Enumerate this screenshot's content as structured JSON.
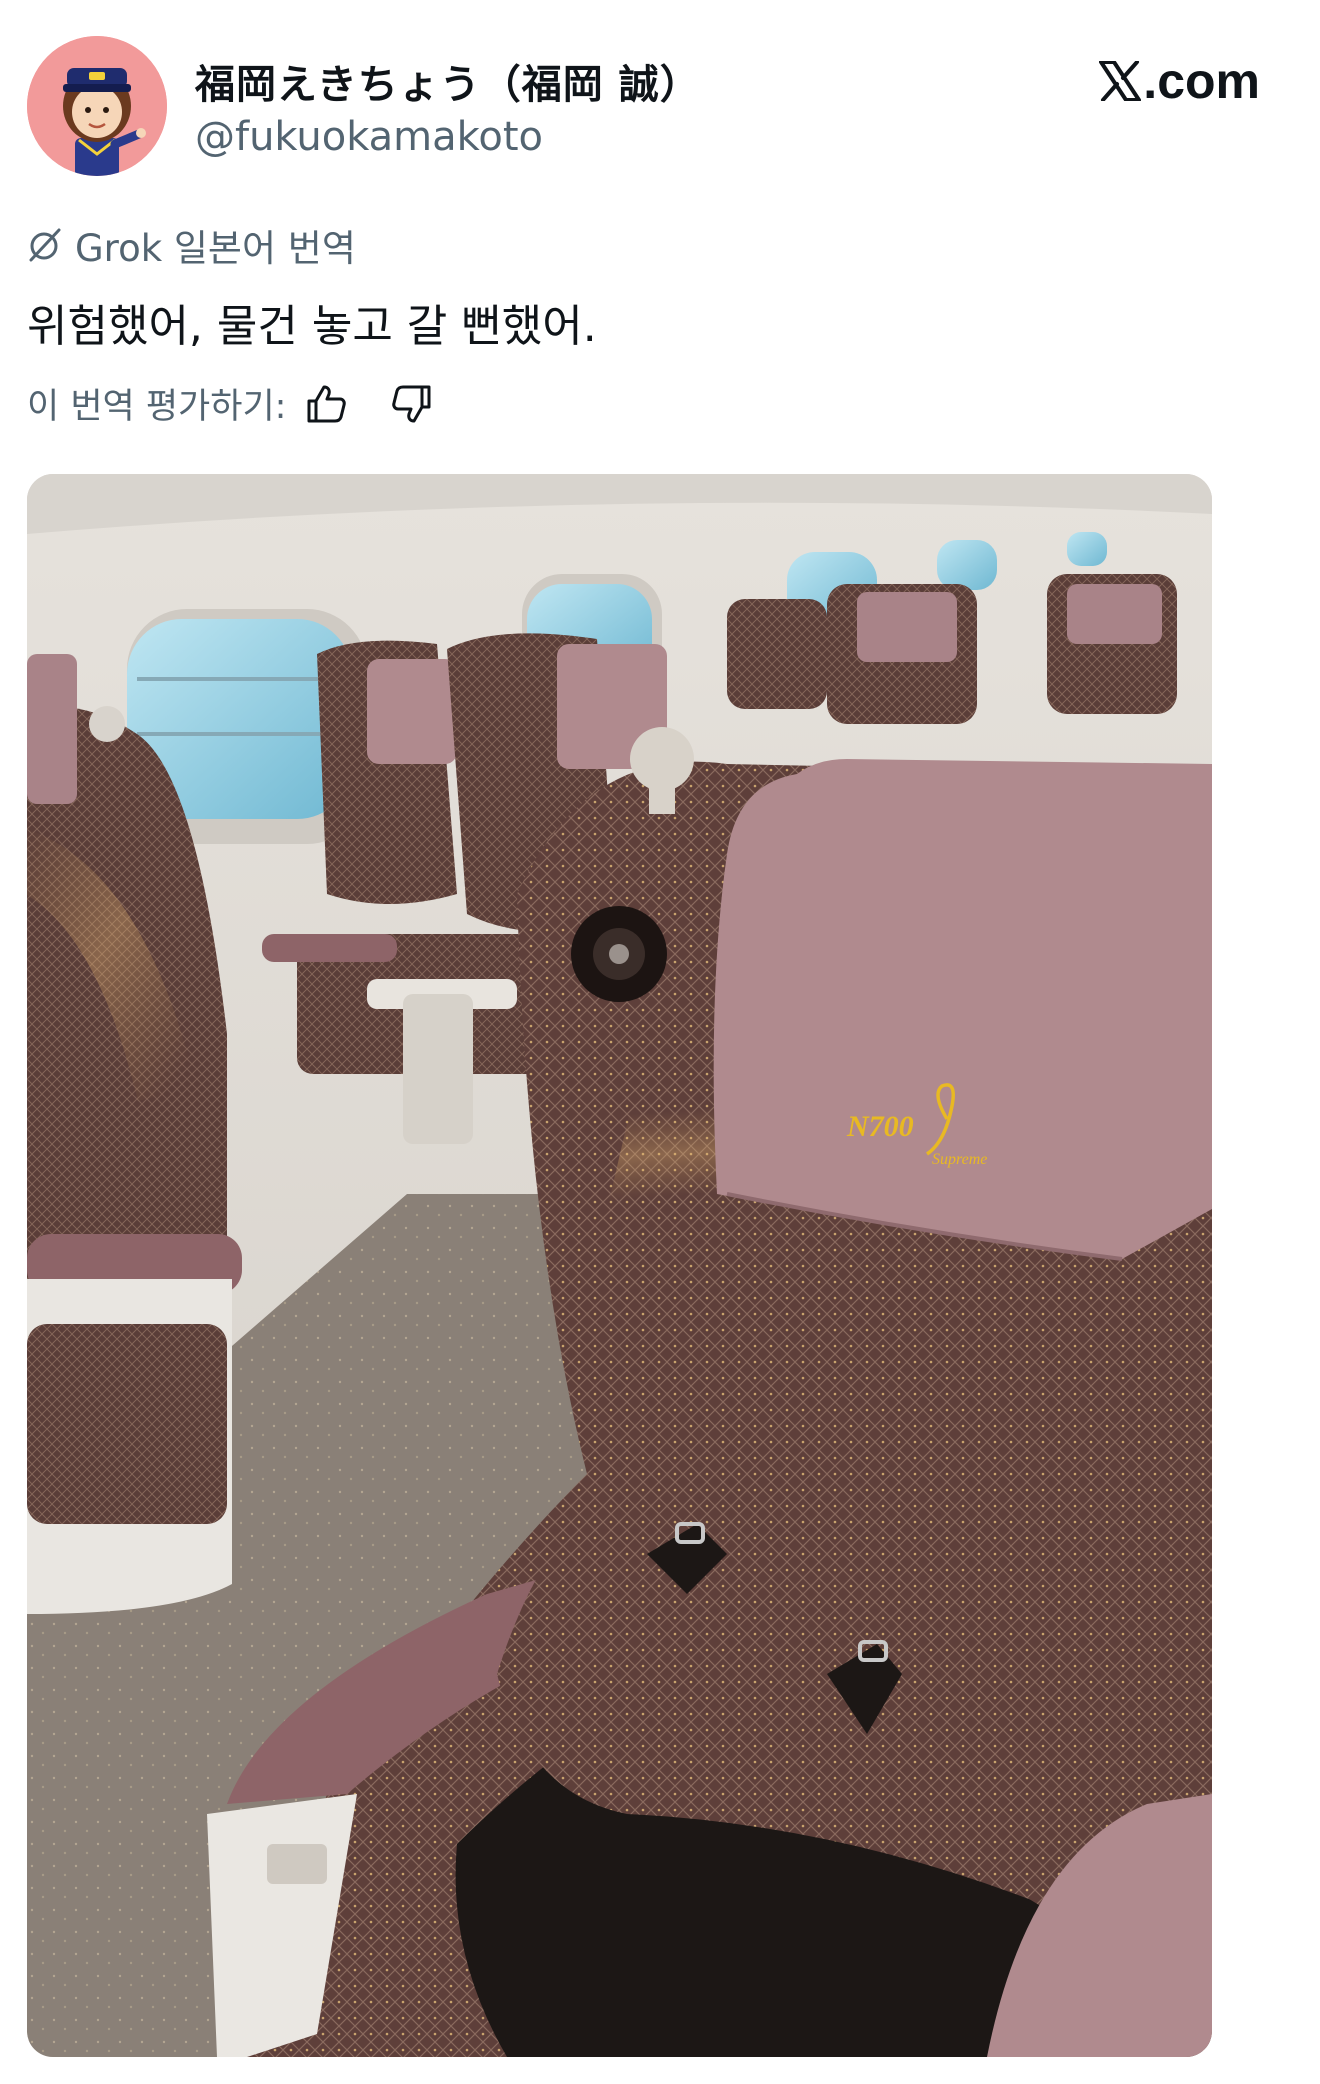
{
  "tweet": {
    "author": {
      "display_name": "福岡えきちょう（福岡 誠）",
      "handle": "@fukuokamakoto",
      "avatar_icon": "avatar-cartoon-station-master"
    },
    "brand": {
      "label": ".com",
      "icon": "x-logo-icon"
    },
    "translation": {
      "source_label": "Grok 일본어 번역",
      "icon": "grok-icon",
      "text": "위험했어, 물건 놓고 갈 뻔했어.",
      "rate_label": "이 번역 평가하기:",
      "thumbs_up_icon": "thumbs-up-icon",
      "thumbs_down_icon": "thumbs-down-icon"
    },
    "media": {
      "headrest_logo": "N700",
      "headrest_logo_script": "Supreme"
    }
  },
  "colors": {
    "text_primary": "#0f1419",
    "text_secondary": "#536471",
    "avatar_bg": "#f29a9a",
    "seat_brown": "#6b4a44",
    "headrest_mauve": "#b08a8e",
    "logo_gold": "#e8b923"
  }
}
